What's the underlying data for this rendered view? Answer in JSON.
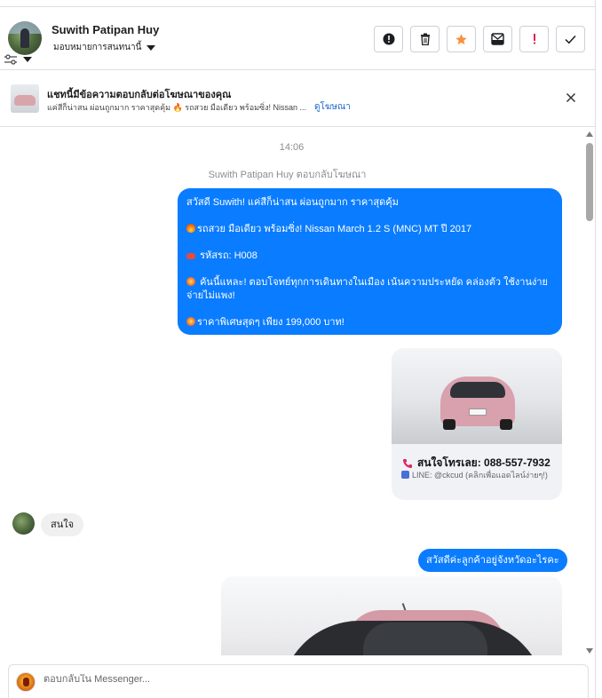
{
  "header": {
    "name": "Suwith Patipan Huy",
    "assign_label": "มอบหมายการสนทนานี้",
    "action_icons": [
      "spam-icon",
      "trash-icon",
      "star-icon",
      "mark-unread-icon",
      "follow-up-icon",
      "done-check-icon"
    ],
    "star_color": "#f7923b",
    "followup_color": "#e41e3f"
  },
  "banner": {
    "title": "แชทนี้มีข้อความตอบกลับต่อโฆษณาของคุณ",
    "subtitle": "แค่สีก็น่าสน ผ่อนถูกมาก ราคาสุดคุ้ม 🔥 รถสวย มือเดียว พร้อมซิ่ง! Nissan ...",
    "link": "ดูโฆษณา"
  },
  "conversation": {
    "time": "14:06",
    "replied_notice": "Suwith Patipan Huy ตอบกลับโฆษณา",
    "ad_message": [
      "สวัสดี Suwith! แค่สีก็น่าสน ผ่อนถูกมาก ราคาสุดคุ้ม",
      "รถสวย มือเดียว พร้อมซิ่ง! Nissan March 1.2 S (MNC) MT ปี 2017",
      "รหัสรถ: H008",
      "คันนี้แหละ! ตอบโจทย์ทุกการเดินทางในเมือง เน้นความประหยัด คล่องตัว ใช้งานง่าย จ่ายไม่แพง!",
      "ราคาพิเศษสุดๆ เพียง 199,000 บาท!"
    ],
    "card": {
      "phone_text": "สนใจโทรเลย: 088-557-7932",
      "line_text": "LINE: @ckcud (คลิกเพื่อแอดไลน์ง่ายๆ!)"
    },
    "incoming_message": "สนใจ",
    "outgoing_message": "สวัสดีค่ะลูกค้าอยู่จังหวัดอะไรคะ"
  },
  "composer": {
    "placeholder": "ตอบกลับใน Messenger..."
  },
  "colors": {
    "messenger_blue": "#0a7cff",
    "link_blue": "#1a63c9",
    "incoming_bubble": "#f0f0f0"
  }
}
